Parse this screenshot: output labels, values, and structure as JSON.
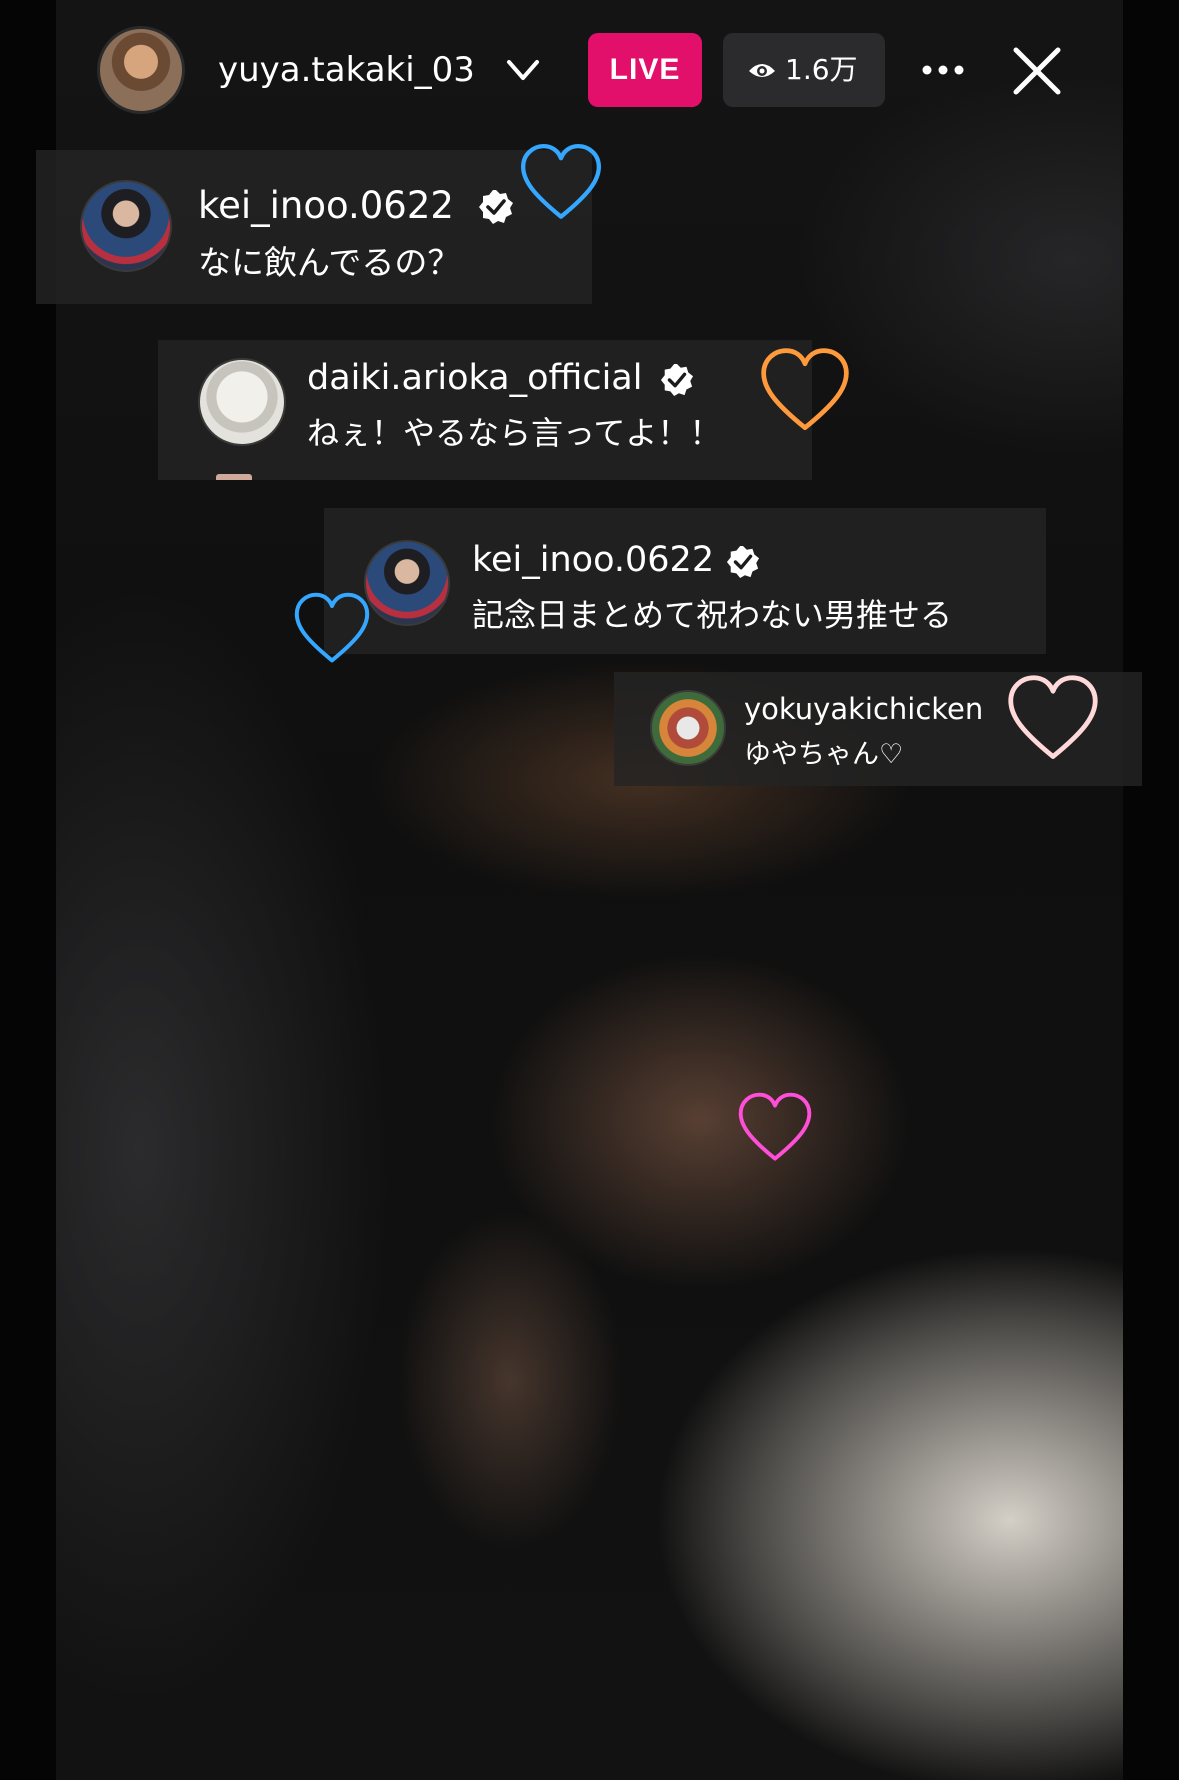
{
  "stream": {
    "host_username": "yuya.takaki_03",
    "live_label": "LIVE",
    "viewer_count": "1.6万",
    "icons": {
      "chevron": "chevron-down-icon",
      "viewers": "eye-icon",
      "more": "more-options-icon",
      "close": "close-icon",
      "verified": "verified-badge-icon",
      "heart": "heart-icon"
    }
  },
  "comments": [
    {
      "username": "kei_inoo.0622",
      "verified": true,
      "message": "なに飲んでるの？"
    },
    {
      "username": "daiki.arioka_official",
      "verified": true,
      "message": "ねぇ！やるなら言ってよ！！"
    },
    {
      "username": "kei_inoo.0622",
      "verified": true,
      "message": "記念日まとめて祝わない男推せる"
    },
    {
      "username": "yokuyakichicken",
      "verified": false,
      "message": "ゆやちゃん♡"
    }
  ],
  "heart_colors": {
    "blue": "#35a7ff",
    "orange": "#ff9a3c",
    "white": "#ffd9d9",
    "pink": "#ff4fd8"
  },
  "accent": {
    "live": "#e3106b",
    "viewer_pill": "#2b2b2d",
    "verified": "#ffffff"
  }
}
